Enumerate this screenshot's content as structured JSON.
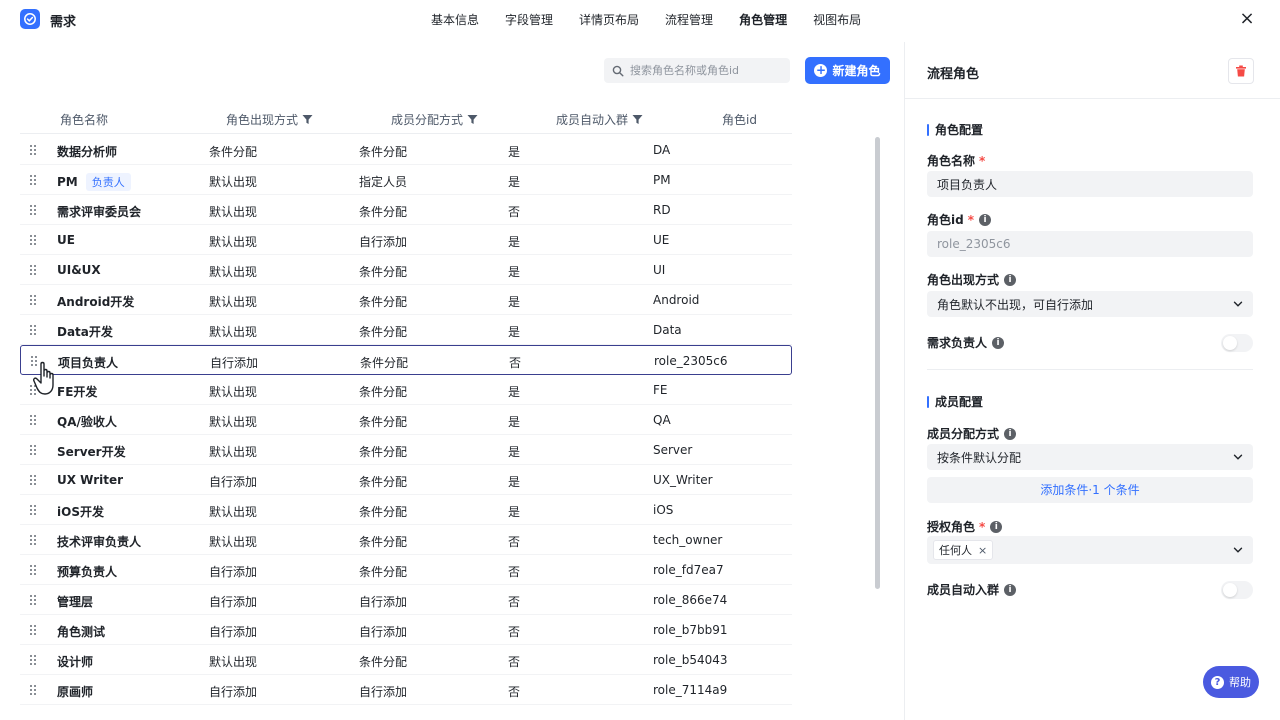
{
  "header": {
    "title": "需求",
    "tabs": [
      {
        "label": "基本信息"
      },
      {
        "label": "字段管理"
      },
      {
        "label": "详情页布局"
      },
      {
        "label": "流程管理"
      },
      {
        "label": "角色管理"
      },
      {
        "label": "视图布局"
      }
    ],
    "active_tab": "角色管理",
    "close_glyph": "×"
  },
  "toolbar": {
    "search_placeholder": "搜索角色名称或角色id",
    "new_role_label": "新建角色",
    "new_role_icon": "plus-circle-icon"
  },
  "table": {
    "columns": [
      "角色名称",
      "角色出现方式",
      "成员分配方式",
      "成员自动入群",
      "角色id"
    ],
    "filterable_columns": [
      1,
      2,
      3
    ],
    "selected_row": 7,
    "rows": [
      {
        "name": "数据分析师",
        "tag": "",
        "appear": "条件分配",
        "assign": "条件分配",
        "auto": "是",
        "id": "DA"
      },
      {
        "name": "PM",
        "tag": "负责人",
        "appear": "默认出现",
        "assign": "指定人员",
        "auto": "是",
        "id": "PM"
      },
      {
        "name": "需求评审委员会",
        "tag": "",
        "appear": "默认出现",
        "assign": "条件分配",
        "auto": "否",
        "id": "RD"
      },
      {
        "name": "UE",
        "tag": "",
        "appear": "默认出现",
        "assign": "自行添加",
        "auto": "是",
        "id": "UE"
      },
      {
        "name": "UI&UX",
        "tag": "",
        "appear": "默认出现",
        "assign": "条件分配",
        "auto": "是",
        "id": "UI"
      },
      {
        "name": "Android开发",
        "tag": "",
        "appear": "默认出现",
        "assign": "条件分配",
        "auto": "是",
        "id": "Android"
      },
      {
        "name": "Data开发",
        "tag": "",
        "appear": "默认出现",
        "assign": "条件分配",
        "auto": "是",
        "id": "Data"
      },
      {
        "name": "项目负责人",
        "tag": "",
        "appear": "自行添加",
        "assign": "条件分配",
        "auto": "否",
        "id": "role_2305c6"
      },
      {
        "name": "FE开发",
        "tag": "",
        "appear": "默认出现",
        "assign": "条件分配",
        "auto": "是",
        "id": "FE"
      },
      {
        "name": "QA/验收人",
        "tag": "",
        "appear": "默认出现",
        "assign": "条件分配",
        "auto": "是",
        "id": "QA"
      },
      {
        "name": "Server开发",
        "tag": "",
        "appear": "默认出现",
        "assign": "条件分配",
        "auto": "是",
        "id": "Server"
      },
      {
        "name": "UX Writer",
        "tag": "",
        "appear": "自行添加",
        "assign": "条件分配",
        "auto": "是",
        "id": "UX_Writer"
      },
      {
        "name": "iOS开发",
        "tag": "",
        "appear": "默认出现",
        "assign": "条件分配",
        "auto": "是",
        "id": "iOS"
      },
      {
        "name": "技术评审负责人",
        "tag": "",
        "appear": "默认出现",
        "assign": "条件分配",
        "auto": "否",
        "id": "tech_owner"
      },
      {
        "name": "预算负责人",
        "tag": "",
        "appear": "自行添加",
        "assign": "条件分配",
        "auto": "否",
        "id": "role_fd7ea7"
      },
      {
        "name": "管理层",
        "tag": "",
        "appear": "自行添加",
        "assign": "自行添加",
        "auto": "否",
        "id": "role_866e74"
      },
      {
        "name": "角色测试",
        "tag": "",
        "appear": "自行添加",
        "assign": "自行添加",
        "auto": "否",
        "id": "role_b7bb91"
      },
      {
        "name": "设计师",
        "tag": "",
        "appear": "默认出现",
        "assign": "条件分配",
        "auto": "否",
        "id": "role_b54043"
      },
      {
        "name": "原画师",
        "tag": "",
        "appear": "自行添加",
        "assign": "自行添加",
        "auto": "否",
        "id": "role_7114a9"
      }
    ]
  },
  "panel": {
    "title": "流程角色",
    "role_config": {
      "section_title": "角色配置",
      "name_label": "角色名称",
      "name_value": "项目负责人",
      "id_label": "角色id",
      "id_value": "role_2305c6",
      "appear_label": "角色出现方式",
      "appear_value": "角色默认不出现，可自行添加",
      "owner_label": "需求负责人",
      "owner_enabled": false
    },
    "member_config": {
      "section_title": "成员配置",
      "assign_label": "成员分配方式",
      "assign_value": "按条件默认分配",
      "add_condition_label": "添加条件·1 个条件",
      "grant_label": "授权角色",
      "grant_chip": "任何人",
      "chip_remove_glyph": "×",
      "auto_group_label": "成员自动入群",
      "auto_group_enabled": false
    },
    "required_mark": "*",
    "info_glyph": "i"
  },
  "help": {
    "label": "帮助",
    "glyph": "?"
  },
  "colors": {
    "accent": "#3370ff",
    "danger": "#f54a45",
    "help_button": "#4a5ae0"
  }
}
